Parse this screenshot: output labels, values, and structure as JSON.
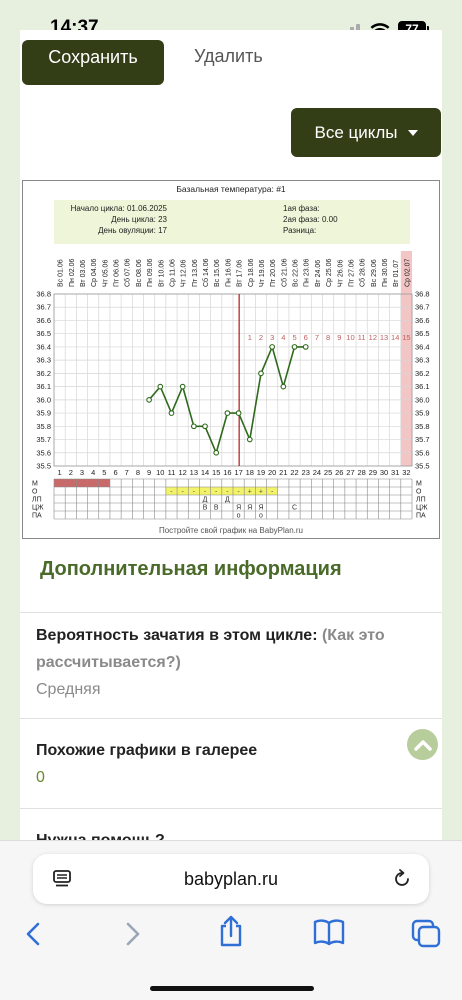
{
  "status": {
    "time": "14:37",
    "battery": "77"
  },
  "actions": {
    "save_label": "Сохранить",
    "delete_label": "Удалить",
    "all_cycles_label": "Все циклы"
  },
  "chart_data": {
    "type": "line",
    "title": "Базальная температура: #1",
    "info": {
      "cycle_start": "Начало цикла: 01.06.2025",
      "cycle_day": "День цикла: 23",
      "ovulation_day": "День овуляции: 17",
      "phase1": "1ая фаза:",
      "phase2": "2ая фаза: 0.00",
      "difference": "Разница:"
    },
    "dates": [
      "Вс 01.06",
      "Пн 02.06",
      "Вт 03.06",
      "Ср 04.06",
      "Чт 05.06",
      "Пт 06.06",
      "Сб 07.06",
      "Вс 08.06",
      "Пн 09.06",
      "Вт 10.06",
      "Ср 11.06",
      "Чт 12.06",
      "Пт 13.06",
      "Сб 14.06",
      "Вс 15.06",
      "Пн 16.06",
      "Вт 17.06",
      "Ср 18.06",
      "Чт 19.06",
      "Пт 20.06",
      "Сб 21.06",
      "Вс 22.06",
      "Пн 23.06",
      "Вт 24.06",
      "Ср 25.06",
      "Чт 26.06",
      "Пт 27.06",
      "Сб 28.06",
      "Вс 29.06",
      "Пн 30.06",
      "Вт 01.07",
      "Ср 02.07"
    ],
    "days": [
      1,
      2,
      3,
      4,
      5,
      6,
      7,
      8,
      9,
      10,
      11,
      12,
      13,
      14,
      15,
      16,
      17,
      18,
      19,
      20,
      21,
      22,
      23,
      24,
      25,
      26,
      27,
      28,
      29,
      30,
      31,
      32
    ],
    "y_ticks": [
      "36.8",
      "36.7",
      "36.6",
      "36.5",
      "36.4",
      "36.3",
      "36.2",
      "36.1",
      "36.0",
      "35.9",
      "35.8",
      "35.7",
      "35.6",
      "35.5"
    ],
    "ylim": [
      35.5,
      36.8
    ],
    "series": [
      {
        "values": [
          [
            9,
            36.0
          ],
          [
            10,
            36.1
          ],
          [
            11,
            35.9
          ],
          [
            12,
            36.1
          ],
          [
            13,
            35.8
          ],
          [
            14,
            35.8
          ],
          [
            15,
            35.6
          ],
          [
            16,
            35.9
          ],
          [
            17,
            35.9
          ],
          [
            18,
            35.7
          ],
          [
            19,
            36.2
          ],
          [
            20,
            36.4
          ],
          [
            21,
            36.1
          ],
          [
            22,
            36.4
          ],
          [
            23,
            36.4
          ]
        ]
      }
    ],
    "ovulation_line_day": 17,
    "luteal_numbers": [
      "1",
      "2",
      "3",
      "4",
      "5",
      "6",
      "7",
      "8",
      "9",
      "10",
      "11",
      "12",
      "13",
      "14",
      "15"
    ],
    "luteal_start_day": 17,
    "highlight_day": 32,
    "row_labels": [
      "М",
      "О",
      "ЛП",
      "ЦЖ",
      "ПА"
    ],
    "menstruation_days": [
      1,
      2,
      3,
      4,
      5
    ],
    "o_row": [
      [
        "11",
        "-"
      ],
      [
        "12",
        "-"
      ],
      [
        "13",
        "-"
      ],
      [
        "14",
        "-"
      ],
      [
        "15",
        "-"
      ],
      [
        "16",
        "-"
      ],
      [
        "17",
        "-"
      ],
      [
        "18",
        "+"
      ],
      [
        "19",
        "+"
      ],
      [
        "20",
        "-"
      ]
    ],
    "lp_row": [
      [
        "14",
        "Д"
      ],
      [
        "16",
        "Д"
      ]
    ],
    "cj_row": [
      [
        "14",
        "В"
      ],
      [
        "15",
        "В"
      ],
      [
        "17",
        "Я"
      ],
      [
        "18",
        "Я"
      ],
      [
        "19",
        "Я"
      ],
      [
        "22",
        "С"
      ]
    ],
    "pa_row": [
      [
        "17",
        "о"
      ],
      [
        "19",
        "о"
      ]
    ],
    "footer": "Постройте свой график на BabyPlan.ru"
  },
  "info_section": {
    "title": "Дополнительная информация",
    "probability_label": "Вероятность зачатия в этом цикле:",
    "probability_hint": "(Как это рассчитывается?)",
    "probability_value": "Средняя",
    "similar_label": "Похожие графики в галерее",
    "similar_value": "0",
    "help_label": "Нужна помощь?"
  },
  "browser": {
    "url": "babyplan.ru"
  }
}
